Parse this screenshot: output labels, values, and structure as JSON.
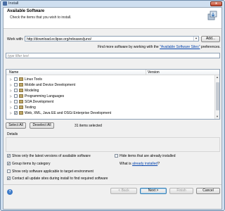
{
  "window": {
    "title": "Install",
    "close_glyph": "x"
  },
  "header": {
    "title": "Available Software",
    "description": "Check the items that you wish to install.",
    "icon": "install-banner-icon"
  },
  "work_with": {
    "label": "Work with:",
    "value": "http://download.eclipse.org/releases/juno/",
    "add_label": "Add...",
    "more_text": "Find more software by working with the",
    "more_link": "\"Available Software Sites\"",
    "more_suffix": "preferences."
  },
  "filter": {
    "placeholder": "type filter text"
  },
  "table": {
    "columns": [
      "Name",
      "Version"
    ],
    "rows": [
      {
        "name": "Linux Tools",
        "checked": false
      },
      {
        "name": "Mobile and Device Development",
        "checked": false
      },
      {
        "name": "Modeling",
        "checked": false
      },
      {
        "name": "Programming Languages",
        "checked": false
      },
      {
        "name": "SOA Development",
        "checked": false
      },
      {
        "name": "Testing",
        "checked": false
      },
      {
        "name": "Web, XML, Java EE and OSGi Enterprise Development",
        "checked": true
      }
    ]
  },
  "selection": {
    "select_all": "Select All",
    "deselect_all": "Deselect All",
    "status": "31 items selected"
  },
  "details": {
    "label": "Details"
  },
  "options": {
    "latest_versions": {
      "label": "Show only the latest versions of available software",
      "checked": true
    },
    "group_by_category": {
      "label": "Group items by category",
      "checked": true
    },
    "target_env": {
      "label": "Show only software applicable to target environment",
      "checked": false
    },
    "contact_sites": {
      "label": "Contact all update sites during install to find required software",
      "checked": true
    },
    "hide_installed": {
      "label": "Hide items that are already installed",
      "checked": false
    },
    "what_is_prefix": "What is",
    "what_is_link": "already installed",
    "what_is_suffix": "?"
  },
  "footer": {
    "back": "< Back",
    "next": "Next >",
    "finish": "Finish",
    "cancel": "Cancel"
  }
}
